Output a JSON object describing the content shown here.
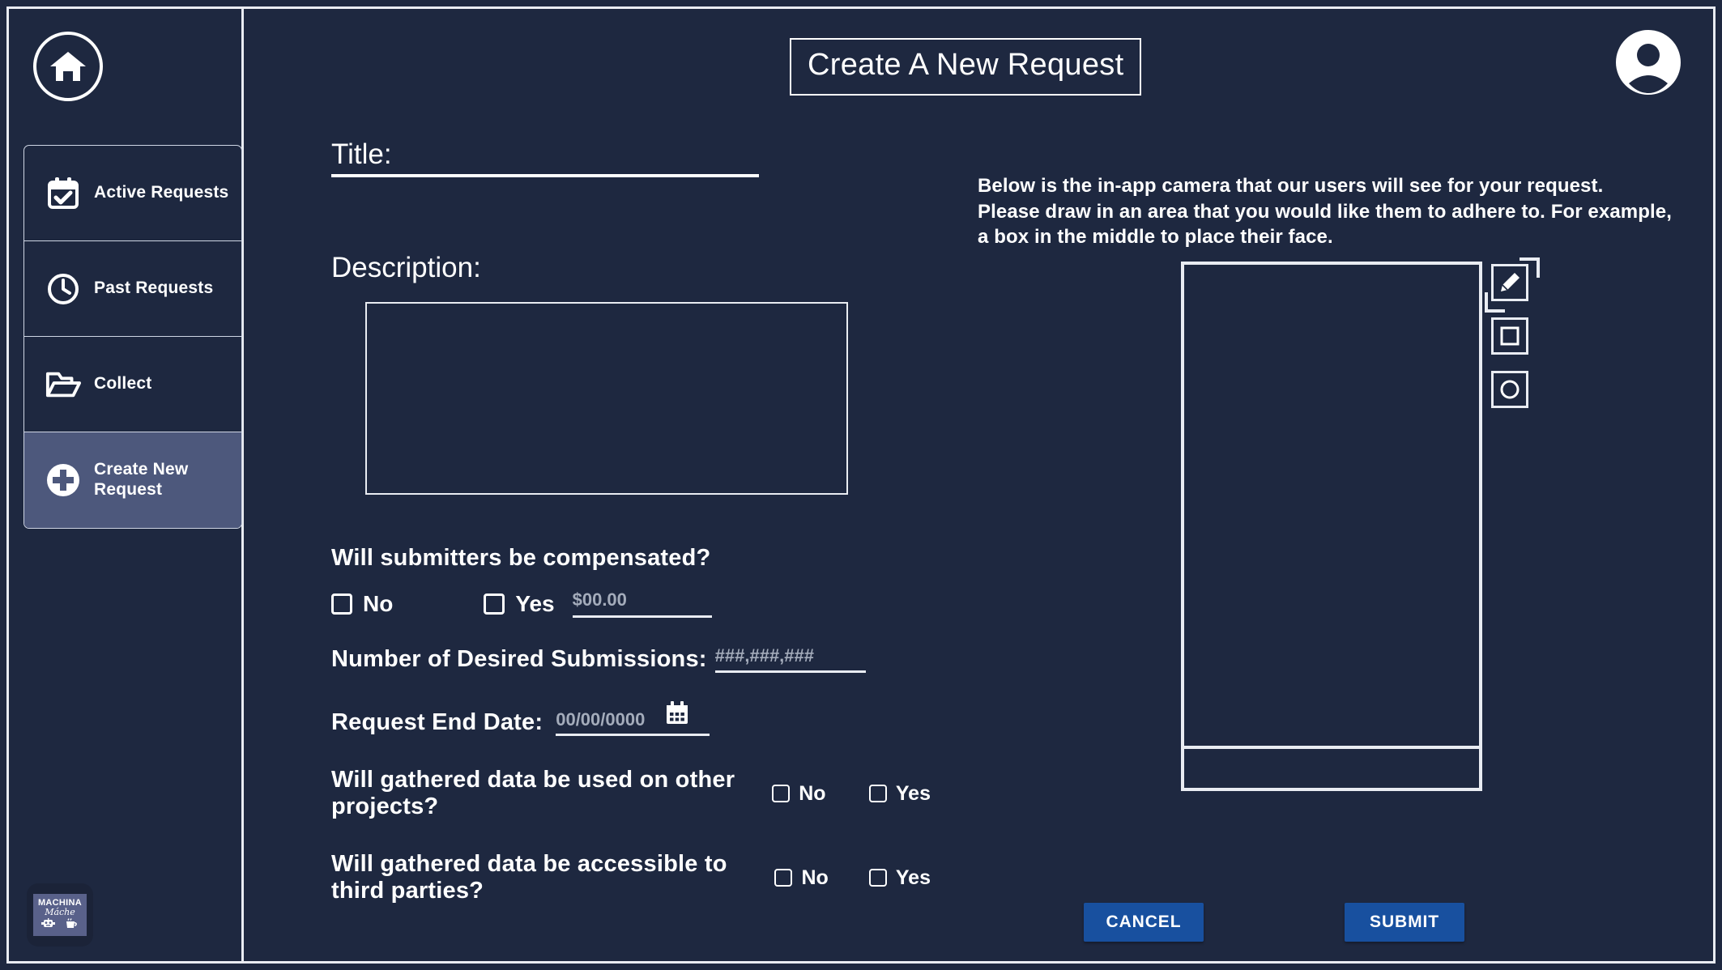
{
  "header": {
    "title": "Create A New Request",
    "avatar_icon": "user-avatar-icon"
  },
  "sidebar": {
    "home_icon": "home-icon",
    "items": [
      {
        "label": "Active Requests",
        "icon": "calendar-check-icon",
        "active": false
      },
      {
        "label": "Past Requests",
        "icon": "clock-icon",
        "active": false
      },
      {
        "label": "Collect",
        "icon": "folder-open-icon",
        "active": false
      },
      {
        "label": "Create New\nRequest",
        "icon": "plus-circle-icon",
        "active": true
      }
    ],
    "brand": {
      "line1": "MACHINA",
      "line2": "Máche",
      "icons": [
        "robot-icon",
        "coffee-cup-icon"
      ]
    }
  },
  "form": {
    "title_label": "Title:",
    "title_value": "",
    "description_label": "Description:",
    "description_value": "",
    "compensation_question": "Will submitters be compensated?",
    "compensation_no_label": "No",
    "compensation_yes_label": "Yes",
    "amount_placeholder": "$00.00",
    "amount_value": "",
    "submissions_label": "Number of Desired Submissions:",
    "submissions_placeholder": "###,###,###",
    "submissions_value": "",
    "end_date_label": "Request End Date:",
    "end_date_placeholder": "00/00/0000",
    "end_date_value": "",
    "calendar_icon": "calendar-icon",
    "other_projects_question": "Will gathered data be used on other projects?",
    "other_projects_no_label": "No",
    "other_projects_yes_label": "Yes",
    "third_parties_question": "Will gathered data be accessible to third parties?",
    "third_parties_no_label": "No",
    "third_parties_yes_label": "Yes"
  },
  "camera_panel": {
    "instructions_line1": "Below is the in-app camera that our users will see for your request.",
    "instructions_line2": "Please draw in an area that you would like them to adhere to. For example,",
    "instructions_line3": "a box in the middle to place their face.",
    "tools": [
      {
        "name": "pencil-draw-tool",
        "icon": "pencil-icon"
      },
      {
        "name": "rectangle-tool",
        "icon": "square-icon"
      },
      {
        "name": "ellipse-tool",
        "icon": "circle-icon"
      }
    ]
  },
  "actions": {
    "cancel_label": "CANCEL",
    "submit_label": "SUBMIT"
  },
  "colors": {
    "background": "#1e2840",
    "outline": "#e9ecf2",
    "active_nav": "#4d587c",
    "button_blue": "#18509f",
    "placeholder": "#a4acbb"
  }
}
